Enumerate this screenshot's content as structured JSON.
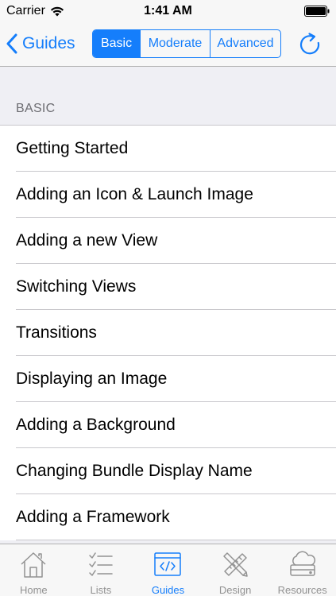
{
  "status_bar": {
    "carrier": "Carrier",
    "time": "1:41 AM",
    "wifi_icon": "wifi-icon",
    "battery_icon": "battery-icon"
  },
  "nav_bar": {
    "back_label": "Guides",
    "back_icon": "chevron-left-icon",
    "segments": [
      "Basic",
      "Moderate",
      "Advanced"
    ],
    "selected_segment": "Basic",
    "refresh_icon": "refresh-icon",
    "accent_color": "#157efb"
  },
  "section": {
    "header": "BASIC",
    "items": [
      "Getting Started",
      "Adding an Icon & Launch Image",
      "Adding a new View",
      "Switching Views",
      "Transitions",
      "Displaying an Image",
      "Adding a Background",
      "Changing Bundle Display Name",
      "Adding a Framework"
    ]
  },
  "tab_bar": {
    "tabs": [
      {
        "label": "Home",
        "icon": "home-icon"
      },
      {
        "label": "Lists",
        "icon": "checklist-icon"
      },
      {
        "label": "Guides",
        "icon": "code-icon"
      },
      {
        "label": "Design",
        "icon": "pencil-ruler-icon"
      },
      {
        "label": "Resources",
        "icon": "cloud-drive-icon"
      }
    ],
    "active_tab": "Guides",
    "active_color": "#157efb",
    "inactive_color": "#929292"
  }
}
